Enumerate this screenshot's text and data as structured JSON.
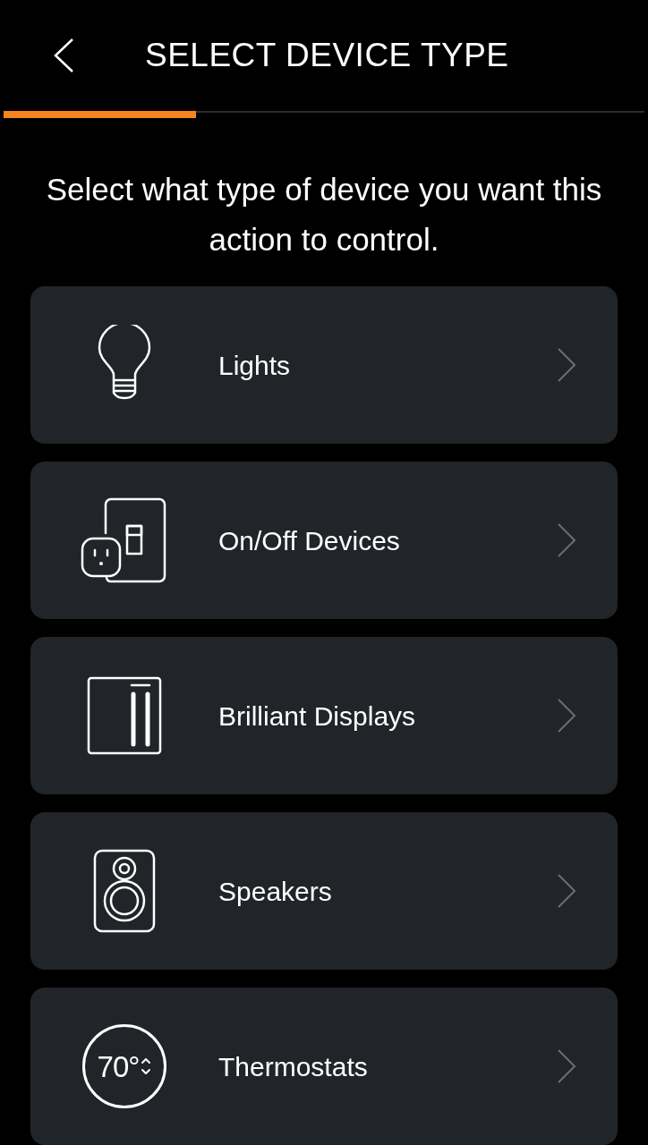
{
  "header": {
    "title": "SELECT DEVICE TYPE"
  },
  "progress": {
    "level": 0.3
  },
  "instruction": "Select what type of device you want this action to control.",
  "device_types": [
    {
      "kind": "bulb",
      "label": "Lights"
    },
    {
      "kind": "plug",
      "label": "On/Off Devices"
    },
    {
      "kind": "display",
      "label": "Brilliant Displays"
    },
    {
      "kind": "speaker",
      "label": "Speakers"
    },
    {
      "kind": "thermostat",
      "label": "Thermostats",
      "icon_text": "70°"
    }
  ]
}
